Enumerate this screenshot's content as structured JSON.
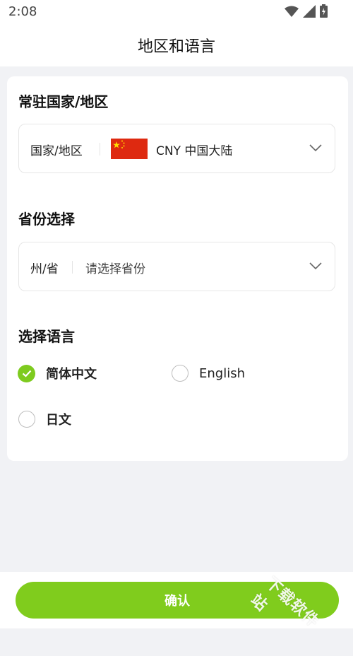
{
  "status_bar": {
    "time": "2:08",
    "icons": [
      "wifi-icon",
      "signal-icon",
      "battery-icon"
    ]
  },
  "header": {
    "title": "地区和语言"
  },
  "country_section": {
    "title": "常驻国家/地区",
    "field_label": "国家/地区",
    "flag": "china-flag",
    "value": "CNY 中国大陆"
  },
  "province_section": {
    "title": "省份选择",
    "field_label": "州/省",
    "placeholder": "请选择省份"
  },
  "language_section": {
    "title": "选择语言",
    "options": [
      {
        "label": "简体中文",
        "selected": true
      },
      {
        "label": "English",
        "selected": false
      },
      {
        "label": "日文",
        "selected": false
      }
    ]
  },
  "footer": {
    "confirm_label": "确认"
  },
  "watermark": "下载软件站",
  "colors": {
    "accent": "#80cc1d",
    "check": "#7ecb1f",
    "background": "#f1f2f5"
  }
}
